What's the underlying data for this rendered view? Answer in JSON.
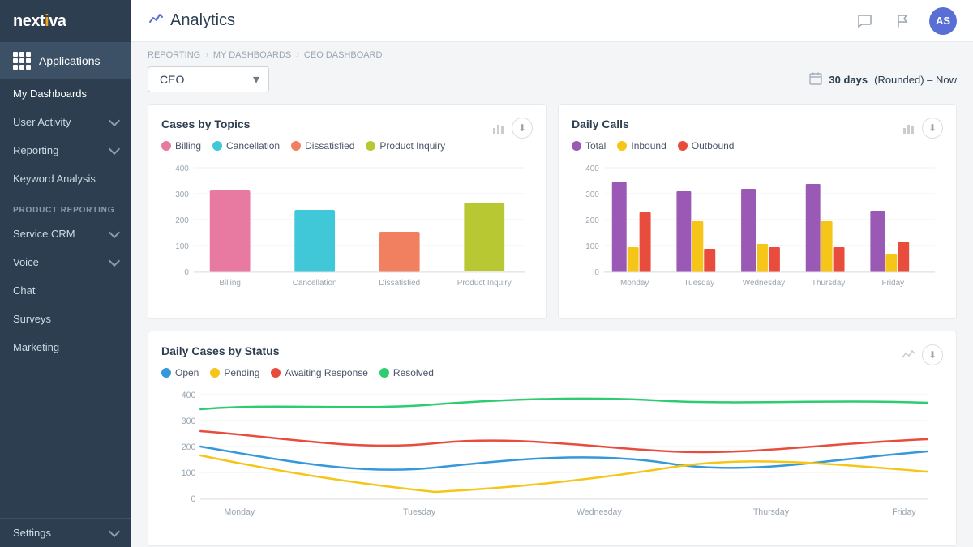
{
  "sidebar": {
    "logo": "nextiva",
    "logo_dot_char": "•",
    "apps_label": "Applications",
    "section_product": "PRODUCT REPORTING",
    "items": [
      {
        "id": "my-dashboards",
        "label": "My Dashboards",
        "hasChevron": false,
        "active": true
      },
      {
        "id": "user-activity",
        "label": "User Activity",
        "hasChevron": true
      },
      {
        "id": "reporting",
        "label": "Reporting",
        "hasChevron": true
      },
      {
        "id": "keyword-analysis",
        "label": "Keyword Analysis",
        "hasChevron": false
      },
      {
        "id": "service-crm",
        "label": "Service CRM",
        "hasChevron": true
      },
      {
        "id": "voice",
        "label": "Voice",
        "hasChevron": true
      },
      {
        "id": "chat",
        "label": "Chat",
        "hasChevron": false
      },
      {
        "id": "surveys",
        "label": "Surveys",
        "hasChevron": false
      },
      {
        "id": "marketing",
        "label": "Marketing",
        "hasChevron": false
      }
    ],
    "settings_label": "Settings"
  },
  "topbar": {
    "title": "Analytics",
    "avatar_initials": "AS"
  },
  "breadcrumb": {
    "items": [
      "REPORTING",
      "MY DASHBOARDS",
      "CEO DASHBOARD"
    ]
  },
  "dashboard": {
    "select_value": "CEO",
    "date_label": "30 days",
    "date_suffix": "(Rounded) – Now"
  },
  "cases_by_topics": {
    "title": "Cases by Topics",
    "legend": [
      {
        "label": "Billing",
        "color": "#e879a0"
      },
      {
        "label": "Cancellation",
        "color": "#40c8d8"
      },
      {
        "label": "Dissatisfied",
        "color": "#f08060"
      },
      {
        "label": "Product Inquiry",
        "color": "#b8c832"
      }
    ],
    "y_labels": [
      "400",
      "300",
      "200",
      "100",
      "0"
    ],
    "bars": [
      {
        "label": "Billing",
        "value": 315,
        "color": "#e879a0"
      },
      {
        "label": "Cancellation",
        "value": 240,
        "color": "#40c8d8"
      },
      {
        "label": "Dissatisfied",
        "value": 155,
        "color": "#f08060"
      },
      {
        "label": "Product Inquiry",
        "value": 265,
        "color": "#b8c832"
      }
    ],
    "max": 400
  },
  "daily_calls": {
    "title": "Daily Calls",
    "legend": [
      {
        "label": "Total",
        "color": "#9b59b6"
      },
      {
        "label": "Inbound",
        "color": "#f5c518"
      },
      {
        "label": "Outbound",
        "color": "#e74c3c"
      }
    ],
    "y_labels": [
      "400",
      "300",
      "200",
      "100",
      "0"
    ],
    "days": [
      "Monday",
      "Tuesday",
      "Wednesday",
      "Thursday",
      "Friday"
    ],
    "groups": [
      {
        "day": "Monday",
        "total": 350,
        "inbound": 95,
        "outbound": 230
      },
      {
        "day": "Tuesday",
        "total": 310,
        "inbound": 195,
        "outbound": 90
      },
      {
        "day": "Wednesday",
        "total": 320,
        "inbound": 110,
        "outbound": 95
      },
      {
        "day": "Thursday",
        "total": 340,
        "inbound": 195,
        "outbound": 95
      },
      {
        "day": "Friday",
        "total": 235,
        "inbound": 65,
        "outbound": 115
      }
    ],
    "max": 400
  },
  "daily_cases": {
    "title": "Daily Cases by Status",
    "legend": [
      {
        "label": "Open",
        "color": "#3498db"
      },
      {
        "label": "Pending",
        "color": "#f5c518"
      },
      {
        "label": "Awaiting Response",
        "color": "#e74c3c"
      },
      {
        "label": "Resolved",
        "color": "#2ecc71"
      }
    ],
    "y_labels": [
      "400",
      "300",
      "200",
      "100",
      "0"
    ],
    "x_labels": [
      "Monday",
      "Tuesday",
      "Wednesday",
      "Thursday",
      "Friday"
    ]
  },
  "icons": {
    "chat": "💬",
    "flag": "🚩",
    "calendar": "📅",
    "download": "⬇",
    "chevron_down": "▾"
  }
}
